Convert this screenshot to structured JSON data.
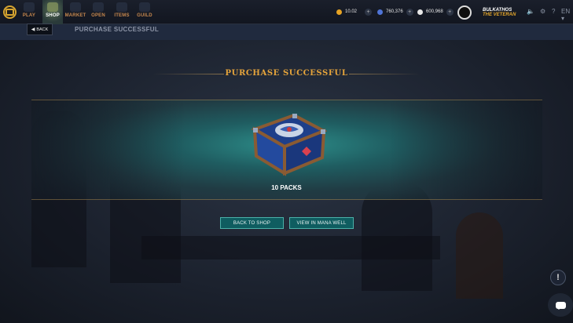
{
  "nav": {
    "items": [
      {
        "label": "PLAY",
        "icon": "play-icon"
      },
      {
        "label": "SHOP",
        "icon": "shop-icon"
      },
      {
        "label": "MARKET",
        "icon": "market-icon"
      },
      {
        "label": "OPEN",
        "icon": "open-icon"
      },
      {
        "label": "ITEMS",
        "icon": "items-icon"
      },
      {
        "label": "GUILD",
        "icon": "guild-icon"
      }
    ],
    "active": "SHOP"
  },
  "currencies": [
    {
      "value": "10.02",
      "color": "#e7a424",
      "icon": "coin-icon"
    },
    {
      "value": "760,376",
      "color": "#4f74d6",
      "icon": "credits-icon"
    },
    {
      "value": "600,968",
      "color": "#e7e7e7",
      "icon": "voucher-icon"
    }
  ],
  "user": {
    "name": "BULKATHOS",
    "title": "THE VETERAN"
  },
  "utilities": {
    "language": "EN"
  },
  "subheader": {
    "back_label": "BACK",
    "title": "PURCHASE SUCCESSFUL"
  },
  "main": {
    "title": "PURCHASE SUCCESSFUL",
    "pack_count": "10 PACKS",
    "buttons": {
      "back_to_shop": "BACK TO SHOP",
      "view_mana_well": "VIEW IN MANA WELL"
    },
    "help_glyph": "!"
  },
  "colors": {
    "accent_gold": "#e5a43b",
    "teal_button": "#0f5d60"
  }
}
